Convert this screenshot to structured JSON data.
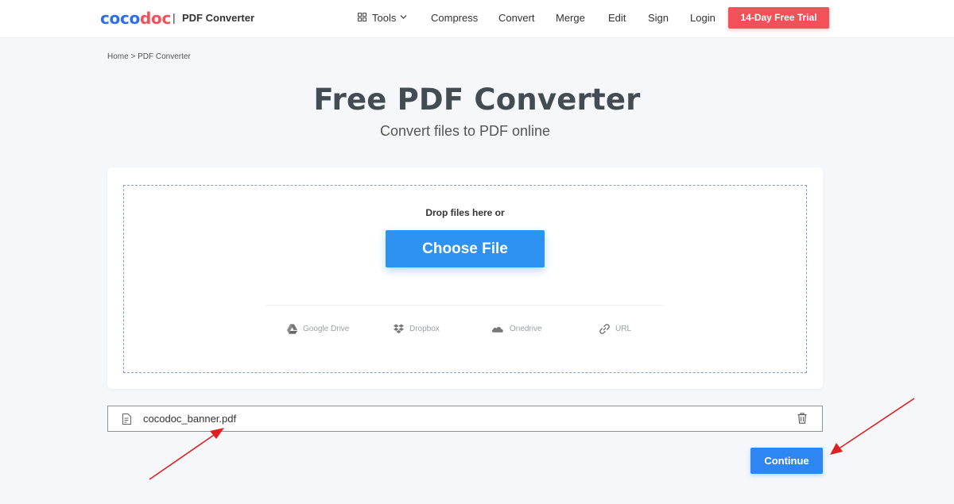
{
  "header": {
    "logo_part1": "coco",
    "logo_part2": "doc",
    "separator": "|",
    "product": "PDF Converter",
    "nav": {
      "tools": "Tools",
      "compress": "Compress",
      "convert": "Convert",
      "merge": "Merge",
      "edit": "Edit",
      "sign": "Sign",
      "login": "Login"
    },
    "trial_button": "14-Day Free Trial"
  },
  "breadcrumb": "Home > PDF Converter",
  "hero": {
    "title": "Free PDF Converter",
    "subtitle": "Convert files to PDF online"
  },
  "upload": {
    "drop_text": "Drop files here or",
    "choose_button": "Choose File",
    "sources": {
      "google_drive": "Google Drive",
      "dropbox": "Dropbox",
      "onedrive": "Onedrive",
      "url": "URL"
    }
  },
  "file": {
    "name": "cocodoc_banner.pdf"
  },
  "continue_button": "Continue",
  "colors": {
    "brand_blue": "#2f6fe4",
    "brand_red": "#f2515a",
    "primary_button": "#2e92f3",
    "annotation_arrow": "#e02020"
  },
  "icons": [
    "tools-grid-icon",
    "chevron-down-icon",
    "google-drive-icon",
    "dropbox-icon",
    "onedrive-icon",
    "link-icon",
    "file-icon",
    "trash-icon",
    "arrow-annotation"
  ]
}
